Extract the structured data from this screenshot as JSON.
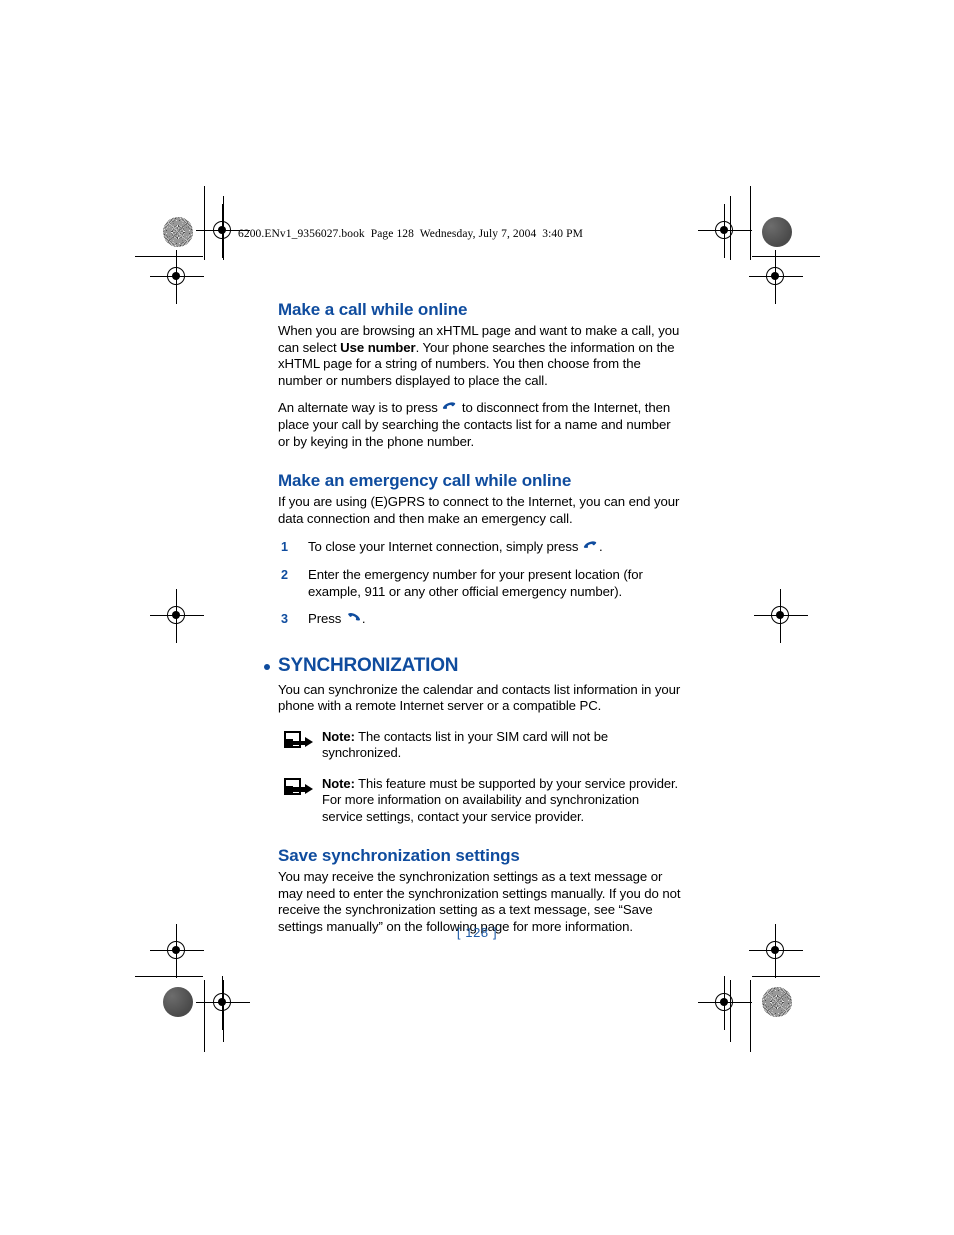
{
  "print_header": "6200.ENv1_9356027.book  Page 128  Wednesday, July 7, 2004  3:40 PM",
  "colors": {
    "heading_blue": "#0f4c9e",
    "page_number_blue": "#1b5aa8",
    "body_black": "#000000"
  },
  "sections": [
    {
      "heading": "Make a call while online",
      "paragraphs": [
        {
          "parts": [
            {
              "type": "text",
              "value": "When you are browsing an xHTML page and want to make a call, you can select "
            },
            {
              "type": "bold",
              "value": "Use number"
            },
            {
              "type": "text",
              "value": ". Your phone searches the information on the xHTML page for a string of numbers. You then choose from the number or numbers displayed to place the call."
            }
          ]
        },
        {
          "parts": [
            {
              "type": "text",
              "value": "An alternate way is to press "
            },
            {
              "type": "icon",
              "value": "end-call-key-icon"
            },
            {
              "type": "text",
              "value": " to disconnect from the Internet, then place your call by searching the contacts list for a name and number or by keying in the phone number."
            }
          ]
        }
      ]
    },
    {
      "heading": "Make an emergency call while online",
      "paragraphs": [
        {
          "parts": [
            {
              "type": "text",
              "value": "If you are using (E)GPRS to connect to the Internet, you can end your data connection and then make an emergency call."
            }
          ]
        }
      ],
      "steps": [
        {
          "num": "1",
          "parts": [
            {
              "type": "text",
              "value": "To close your Internet connection, simply press "
            },
            {
              "type": "icon",
              "value": "end-call-key-icon"
            },
            {
              "type": "text",
              "value": "."
            }
          ]
        },
        {
          "num": "2",
          "parts": [
            {
              "type": "text",
              "value": "Enter the emergency number for your present location (for example, 911 or any other official emergency number)."
            }
          ]
        },
        {
          "num": "3",
          "parts": [
            {
              "type": "text",
              "value": "Press "
            },
            {
              "type": "icon",
              "value": "call-key-icon"
            },
            {
              "type": "text",
              "value": "."
            }
          ]
        }
      ]
    }
  ],
  "chapter": {
    "heading": "SYNCHRONIZATION",
    "bullet": "•",
    "intro": "You can synchronize the calendar and contacts list information in your phone with a remote Internet server or a compatible PC.",
    "notes": [
      {
        "label": "Note:",
        "text": " The contacts list in your SIM card will not be synchronized."
      },
      {
        "label": "Note:",
        "text": " This feature must be supported by your service provider. For more information on availability and synchronization service settings, contact your service provider."
      }
    ],
    "subsection": {
      "heading": "Save synchronization settings",
      "text": "You may receive the synchronization settings as a text message or may need to enter the synchronization settings manually. If you do not receive the synchronization setting as a text message, see “Save settings manually” on the following page for more information."
    }
  },
  "page_number": "[ 128 ]"
}
